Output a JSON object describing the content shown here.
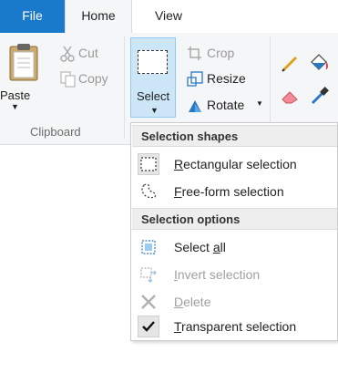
{
  "tabs": {
    "file": "File",
    "home": "Home",
    "view": "View"
  },
  "clipboard": {
    "paste": "Paste",
    "cut": "Cut",
    "copy": "Copy",
    "group_label": "Clipboard"
  },
  "image": {
    "select": "Select",
    "crop": "Crop",
    "resize": "Resize",
    "rotate": "Rotate"
  },
  "select_menu": {
    "shapes_header": "Selection shapes",
    "options_header": "Selection options",
    "rectangular": {
      "key": "R",
      "rest": "ectangular selection"
    },
    "freeform": {
      "key": "F",
      "rest": "ree-form selection"
    },
    "select_all": {
      "pre": "Select ",
      "key": "a",
      "rest": "ll"
    },
    "invert": {
      "key": "I",
      "rest": "nvert selection"
    },
    "delete": {
      "key": "D",
      "rest": "elete"
    },
    "transparent": {
      "key": "T",
      "rest": "ransparent selection"
    }
  },
  "colors": {
    "file_tab": "#1979ca",
    "accent": "#2b78c4",
    "select_highlight": "#cde6f7"
  }
}
